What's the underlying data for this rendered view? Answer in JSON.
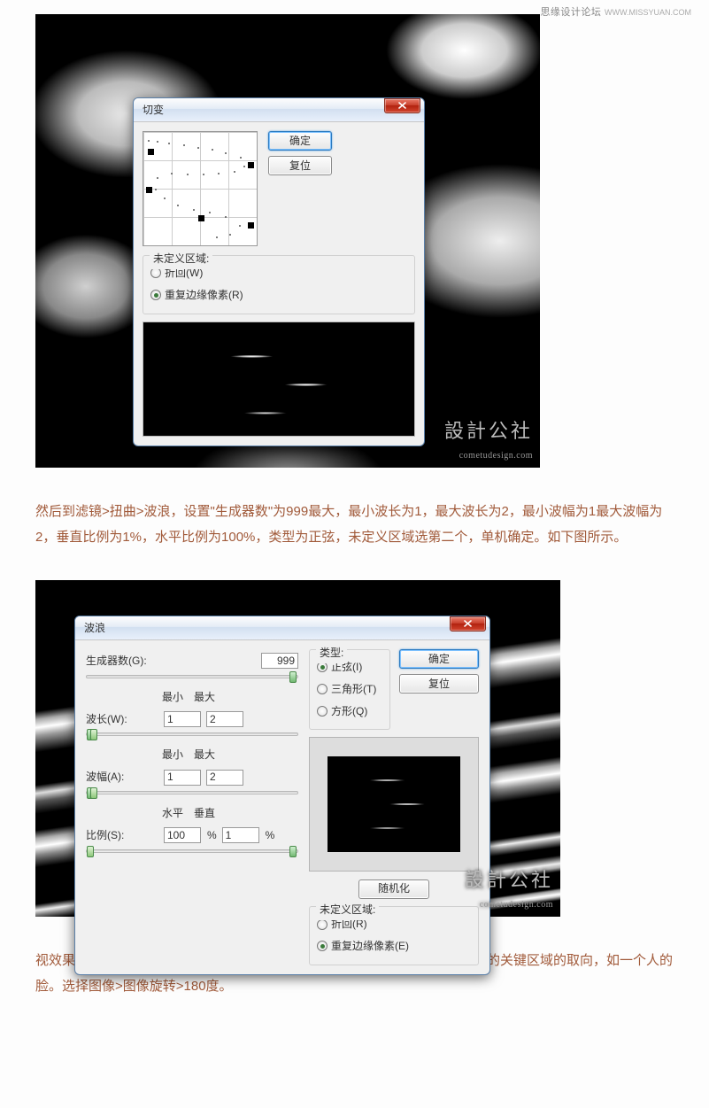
{
  "header": {
    "site": "思缘设计论坛",
    "url": "WWW.MISSYUAN.COM"
  },
  "fig_watermark": {
    "top": "設計公社",
    "bottom": "cometudesign.com"
  },
  "dialog1": {
    "title": "切变",
    "ok": "确定",
    "reset": "复位",
    "undefined_legend": "未定义区域:",
    "wrap": "折回(W)",
    "repeat": "重复边缘像素(R)"
  },
  "para1": "然后到滤镜>扭曲>波浪，设置\"生成器数\"为999最大，最小波长为1，最大波长为2，最小波幅为1最大波幅为2，垂直比例为1%，水平比例为100%，类型为正弦，未定义区域选第二个，单机确定。如下图所示。",
  "dialog2": {
    "title": "波浪",
    "ok": "确定",
    "reset": "复位",
    "randomize": "随机化",
    "generators_label": "生成器数(G):",
    "generators_value": "999",
    "min_label": "最小",
    "max_label": "最大",
    "wavelength_label": "波长(W):",
    "wavelength_min": "1",
    "wavelength_max": "2",
    "amplitude_label": "波幅(A):",
    "amplitude_min": "1",
    "amplitude_max": "2",
    "horiz_label": "水平",
    "vert_label": "垂直",
    "scale_label": "比例(S):",
    "scale_horiz": "100",
    "scale_vert": "1",
    "type_legend": "类型:",
    "type_sine": "正弦(I)",
    "type_triangle": "三角形(T)",
    "type_square": "方形(Q)",
    "undef_legend": "未定义区域:",
    "undef_wrap": "折回(R)",
    "undef_repeat": "重复边缘像素(E)"
  },
  "para2": "视效果被施加到照片的布局，可能有必要改变这个失真文件，以避免扭曲图像的关键区域的取向，如一个人的脸。选择图像>图像旋转>180度。"
}
